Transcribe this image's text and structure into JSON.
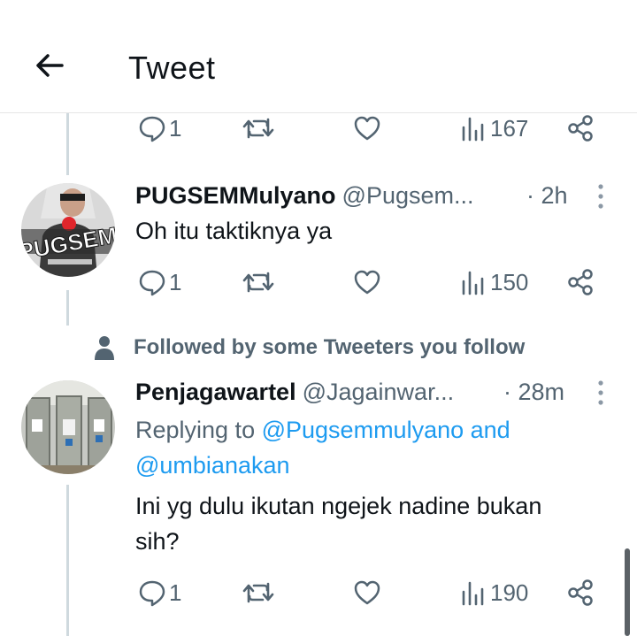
{
  "header": {
    "title": "Tweet"
  },
  "tweets": [
    {
      "stats": {
        "replies": "1",
        "views": "167"
      }
    },
    {
      "display_name": "PUGSEMMulyano",
      "handle": "@Pugsem...",
      "time": "· 2h",
      "text": "Oh itu taktiknya ya",
      "avatar_text": "PUGSEM",
      "stats": {
        "replies": "1",
        "views": "150"
      }
    },
    {
      "display_name": "Penjagawartel",
      "handle": "@Jagainwar...",
      "time": "· 28m",
      "replying_prefix": "Replying to",
      "replying_to_1": "@Pugsemmulyano",
      "replying_and": "and",
      "replying_to_2": "@umbianakan",
      "text_line1": "Ini yg dulu ikutan ngejek nadine bukan",
      "text_line2": "sih?",
      "stats": {
        "replies": "1",
        "views": "190"
      }
    }
  ],
  "followed_notice": "Followed by some Tweeters you follow",
  "icons": {
    "back": "back-arrow-icon",
    "reply": "reply-icon",
    "retweet": "retweet-icon",
    "like": "heart-icon",
    "views": "views-icon",
    "share": "share-icon",
    "more": "more-vertical-icon",
    "person": "person-icon"
  },
  "colors": {
    "text": "#0f1419",
    "secondary": "#536471",
    "link": "#1d9bf0",
    "thread_line": "#cfd9de"
  }
}
